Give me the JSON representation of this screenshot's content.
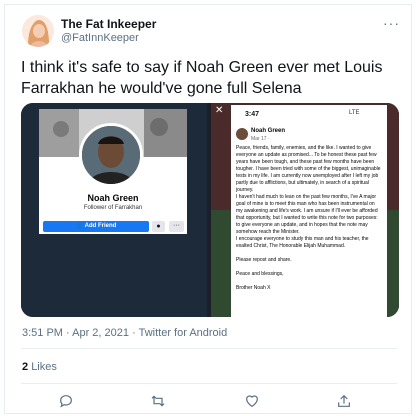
{
  "user": {
    "display_name": "The Fat Inkeeper",
    "handle": "@FatInnKeeper"
  },
  "menu_icon": "more-horizontal-icon",
  "tweet": {
    "text": "I think it's safe to say if Noah Green ever met Louis Farrakhan he would've gone full Selena"
  },
  "media": {
    "left_image": {
      "profile_name": "Noah Green",
      "profile_subtitle": "Follower of Farrakhan",
      "add_friend_label": "Add Friend",
      "messenger_icon": "messenger-icon",
      "more_icon": "more-icon"
    },
    "right_image": {
      "close_icon": "close-icon",
      "phone_time": "3:47",
      "status": "LTE",
      "post_author": "Noah Green",
      "post_date": "Mar 17 · ",
      "post_body": "Peace, friends, family, enemies, and the like. I wanted to give everyone an update as promised... To be honest these past few years have been tough, and these past few months have been tougher. I have been tried with some of the biggest, unimaginable tests in my life. I am currently now unemployed after I left my job partly due to afflictions, but ultimately, in search of a spiritual journey.\nI haven't had much to lean on the past few months, I've A major goal of mine is to meet this man who has been instrumental on my awakening and life's work. I am unsure if I'll ever be afforded that opportunity, but I wanted to write this note for two purposes: to give everyone an update, and in hopes that the note may somehow reach the Minister.\nI encourage everyone to study this man and his teacher, the exalted Christ, The Honorable Elijah Muhammad.\n\nPlease repost and share.\n\nPeace and blessings,\n\nBrother Noah X"
    }
  },
  "timestamp": "3:51 PM · Apr 2, 2021 · Twitter for Android",
  "likes": {
    "count": "2",
    "label": "Likes"
  },
  "actions": {
    "reply_icon": "reply-icon",
    "retweet_icon": "retweet-icon",
    "like_icon": "heart-icon",
    "share_icon": "share-icon"
  },
  "colors": {
    "text_primary": "#0f1419",
    "text_secondary": "#5b7083",
    "facebook_blue": "#1877f2",
    "border": "#ebeef0"
  }
}
